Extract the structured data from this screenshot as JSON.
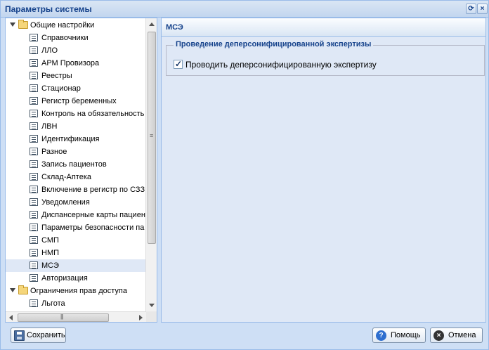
{
  "window": {
    "title": "Параметры системы",
    "refresh_icon": "refresh-icon",
    "close_icon": "close-icon"
  },
  "tree": {
    "groups": [
      {
        "label": "Общие настройки",
        "items": [
          "Справочники",
          "ЛЛО",
          "АРМ Провизора",
          "Реестры",
          "Стационар",
          "Регистр беременных",
          "Контроль на обязательность",
          "ЛВН",
          "Идентификация",
          "Разное",
          "Запись пациентов",
          "Склад-Аптека",
          "Включение в регистр по СЗЗ",
          "Уведомления",
          "Диспансерные карты пациен",
          "Параметры безопасности па",
          "СМП",
          "НМП",
          "МСЭ",
          "Авторизация"
        ]
      },
      {
        "label": "Ограничения прав доступа",
        "items": [
          "Льгота"
        ]
      }
    ],
    "selected": "МСЭ"
  },
  "content": {
    "panel_title": "МСЭ",
    "fieldset_legend": "Проведение деперсонифицированной экспертизы",
    "checkbox_label": "Проводить деперсонифицированную экспертизу",
    "checkbox_checked": true
  },
  "buttons": {
    "save": "Сохранить",
    "help": "Помощь",
    "cancel": "Отмена"
  }
}
